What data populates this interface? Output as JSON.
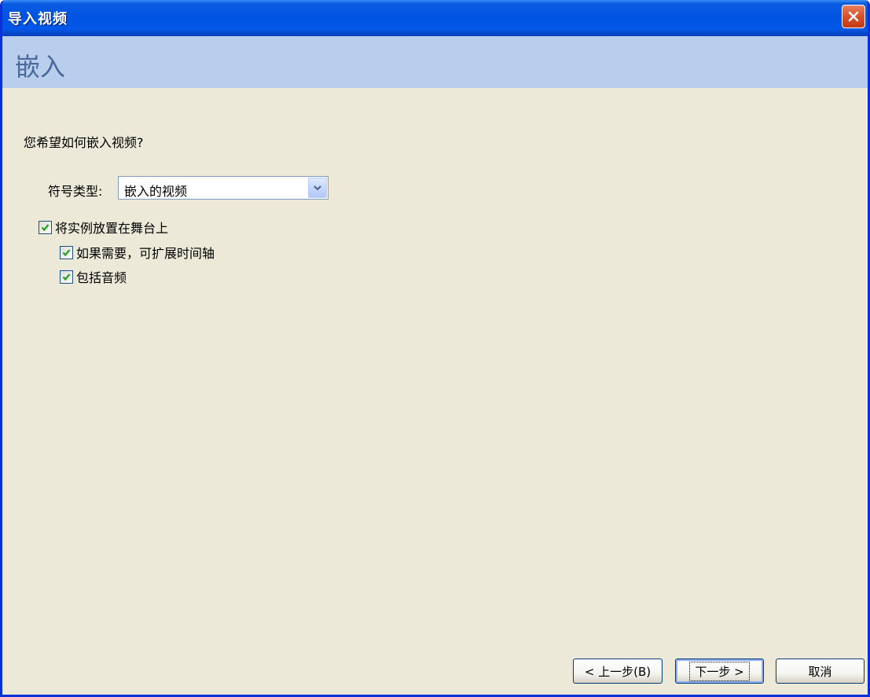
{
  "window": {
    "title": "导入视频"
  },
  "header": {
    "title": "嵌入"
  },
  "main": {
    "question": "您希望如何嵌入视频?",
    "symbol_type": {
      "label": "符号类型:",
      "selected": "嵌入的视频"
    },
    "checkboxes": [
      {
        "label": "将实例放置在舞台上",
        "checked": true
      },
      {
        "label": "如果需要，可扩展时间轴",
        "checked": true
      },
      {
        "label": "包括音频",
        "checked": true
      }
    ]
  },
  "footer": {
    "back_label": "< 上一步(B)",
    "next_label": "下一步 >",
    "cancel_label": "取消"
  },
  "colors": {
    "titlebar": "#0054e3",
    "header_band": "#b9cdec",
    "body": "#ece9d8",
    "checkmark": "#21a121"
  },
  "icons": {
    "close": "close-icon",
    "dropdown": "chevron-down-icon",
    "check": "checkmark-icon"
  }
}
